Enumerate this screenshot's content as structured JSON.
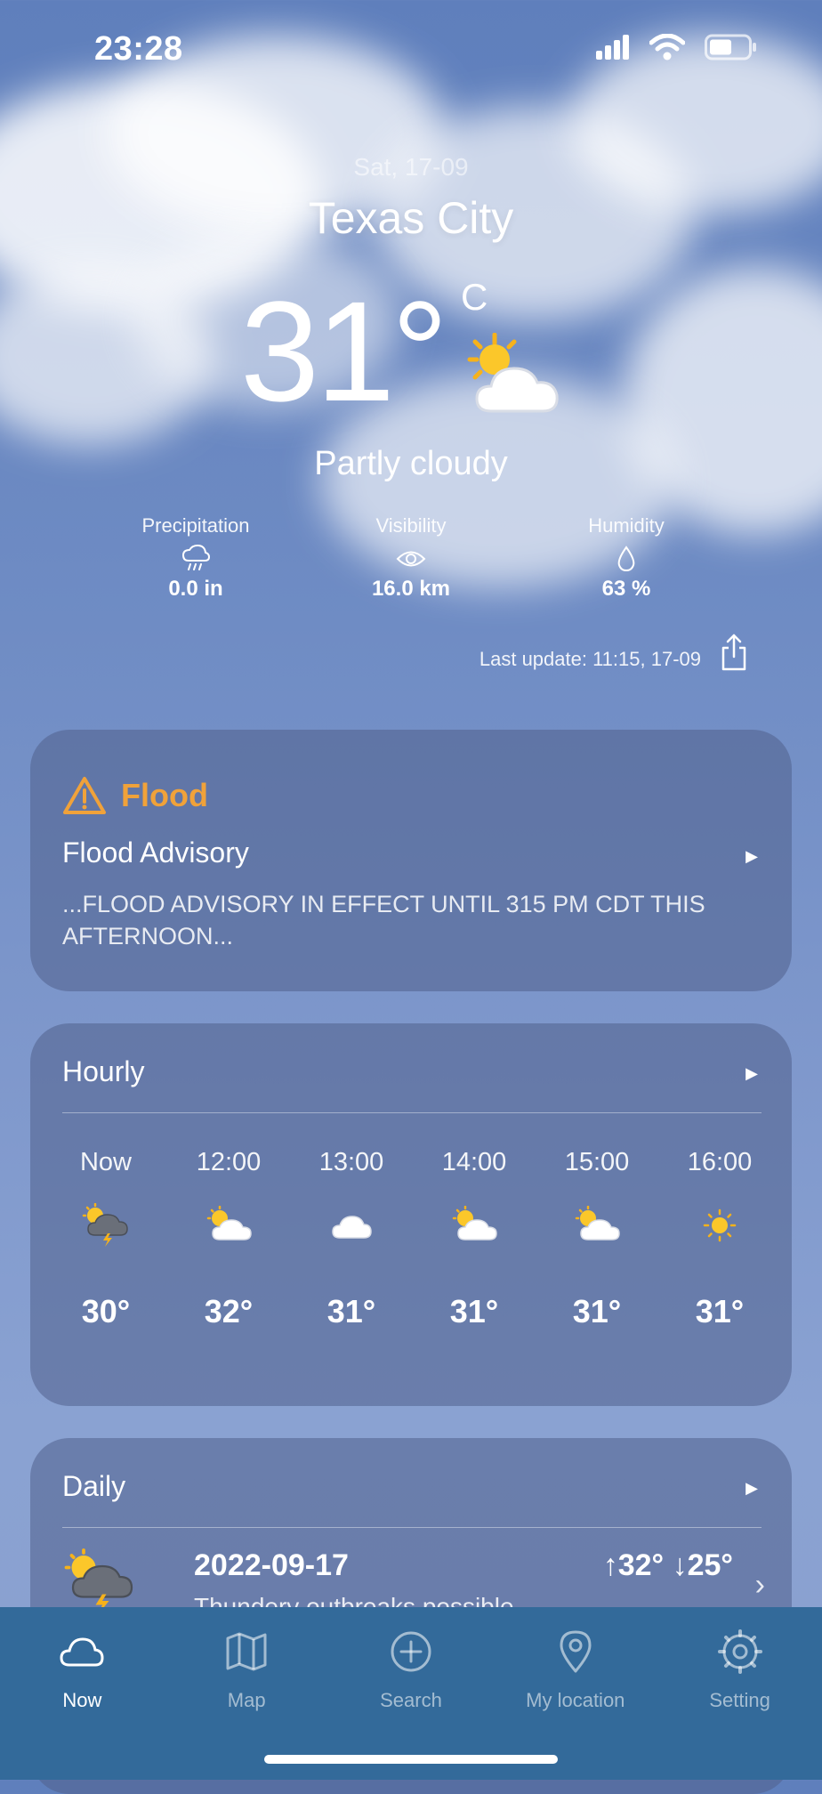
{
  "status": {
    "time": "23:28"
  },
  "header": {
    "date": "Sat, 17-09",
    "city": "Texas City"
  },
  "current": {
    "temperature": "31°",
    "unit": "C",
    "condition": "Partly cloudy",
    "icon": "partly-cloudy-sun-icon"
  },
  "metrics": [
    {
      "label": "Precipitation",
      "value": "0.0 in",
      "icon": "rain-icon"
    },
    {
      "label": "Visibility",
      "value": "16.0 km",
      "icon": "eye-icon"
    },
    {
      "label": "Humidity",
      "value": "63 %",
      "icon": "droplet-icon"
    }
  ],
  "last_update": "Last update: 11:15, 17-09",
  "alert": {
    "title": "Flood",
    "subtitle": "Flood Advisory",
    "text": "...FLOOD ADVISORY IN EFFECT UNTIL 315 PM CDT THIS AFTERNOON...",
    "color": "#f0a23a"
  },
  "hourly": {
    "title": "Hourly",
    "items": [
      {
        "time": "Now",
        "temp": "30°",
        "icon": "thunderstorm-sun-icon"
      },
      {
        "time": "12:00",
        "temp": "32°",
        "icon": "partly-cloudy-sun-icon"
      },
      {
        "time": "13:00",
        "temp": "31°",
        "icon": "cloud-icon"
      },
      {
        "time": "14:00",
        "temp": "31°",
        "icon": "partly-cloudy-sun-icon"
      },
      {
        "time": "15:00",
        "temp": "31°",
        "icon": "partly-cloudy-sun-icon"
      },
      {
        "time": "16:00",
        "temp": "31°",
        "icon": "sun-icon"
      }
    ]
  },
  "daily": {
    "title": "Daily",
    "items": [
      {
        "date": "2022-09-17",
        "description": "Thundery outbreaks possible",
        "high": "32°",
        "low": "25°",
        "icon": "thunderstorm-sun-icon"
      }
    ]
  },
  "tabbar": {
    "items": [
      {
        "label": "Now",
        "icon": "cloud-icon",
        "active": true
      },
      {
        "label": "Map",
        "icon": "map-icon",
        "active": false
      },
      {
        "label": "Search",
        "icon": "plus-circle-icon",
        "active": false
      },
      {
        "label": "My location",
        "icon": "location-pin-icon",
        "active": false
      },
      {
        "label": "Setting",
        "icon": "gear-icon",
        "active": false
      }
    ]
  }
}
